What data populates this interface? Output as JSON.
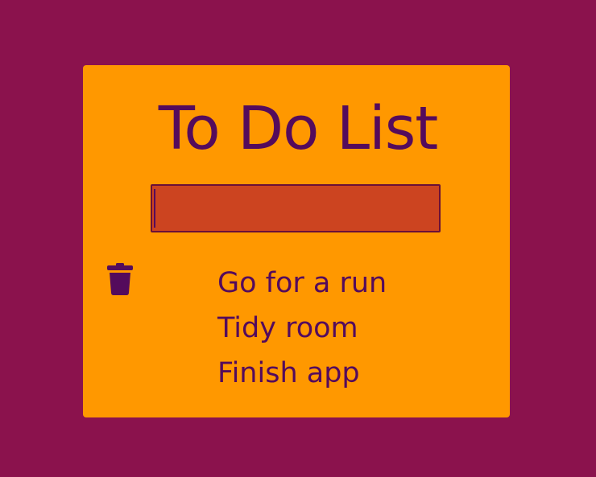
{
  "app": {
    "title": "To Do List"
  },
  "input": {
    "value": "",
    "placeholder": ""
  },
  "icons": {
    "delete": "trash-icon"
  },
  "todos": [
    {
      "text": "Go for a run"
    },
    {
      "text": "Tidy room"
    },
    {
      "text": "Finish app"
    }
  ],
  "colors": {
    "background": "#8b124d",
    "card": "#ff9800",
    "text": "#540b5c",
    "input_background": "#cc4420",
    "input_border": "#6a1038"
  }
}
